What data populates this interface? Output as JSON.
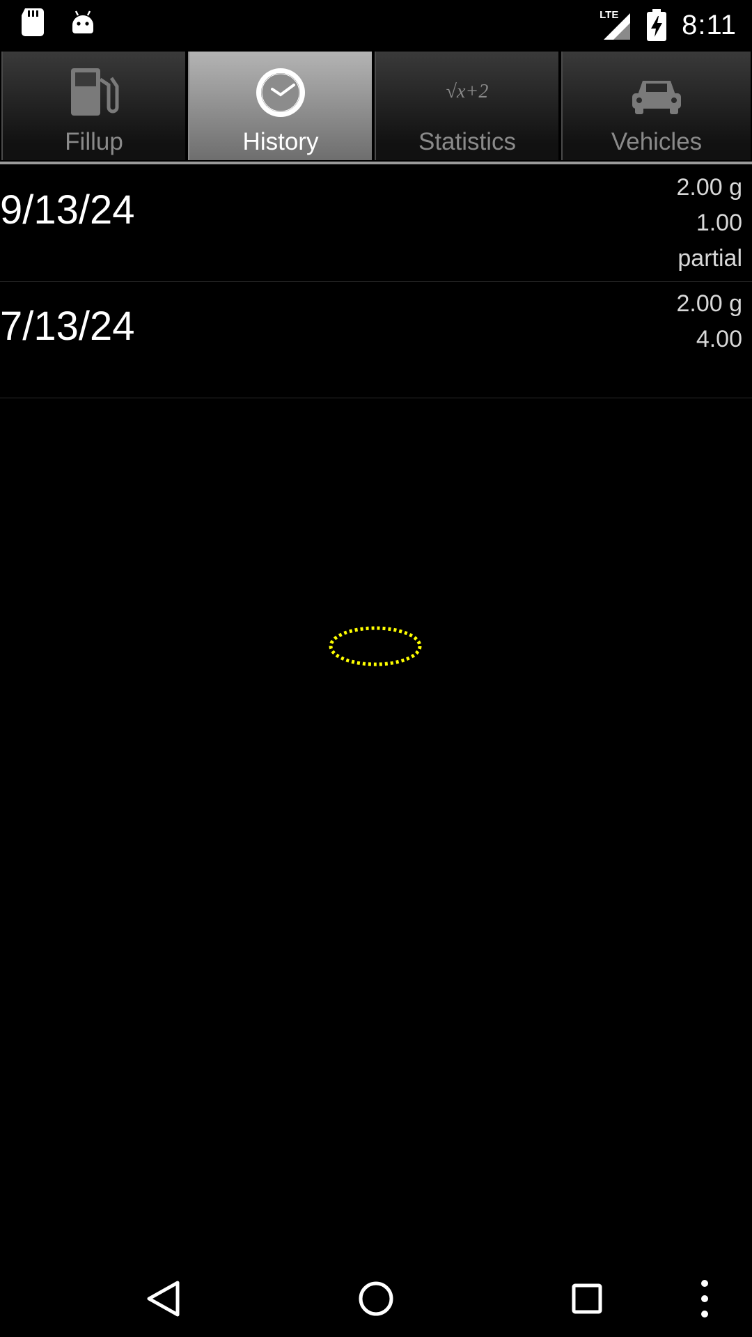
{
  "status_bar": {
    "time": "8:11",
    "network": "LTE",
    "icons": [
      "sd-card-icon",
      "android-icon",
      "lte-signal-icon",
      "battery-charging-icon"
    ]
  },
  "tabs": [
    {
      "label": "Fillup",
      "icon": "fuel-pump-icon",
      "active": false
    },
    {
      "label": "History",
      "icon": "clock-icon",
      "active": true
    },
    {
      "label": "Statistics",
      "icon": "sqrt-formula-icon",
      "active": false,
      "icon_text": "√x+2"
    },
    {
      "label": "Vehicles",
      "icon": "car-icon",
      "active": false
    }
  ],
  "history": [
    {
      "date": "9/13/24",
      "amount": "2.00 g",
      "price": "1.00",
      "note": "partial"
    },
    {
      "date": "7/13/24",
      "amount": "2.00 g",
      "price": "4.00",
      "note": ""
    }
  ],
  "spinner": {
    "color": "#ffff00"
  },
  "nav": [
    "back-icon",
    "home-icon",
    "recents-icon",
    "overflow-menu-icon"
  ]
}
